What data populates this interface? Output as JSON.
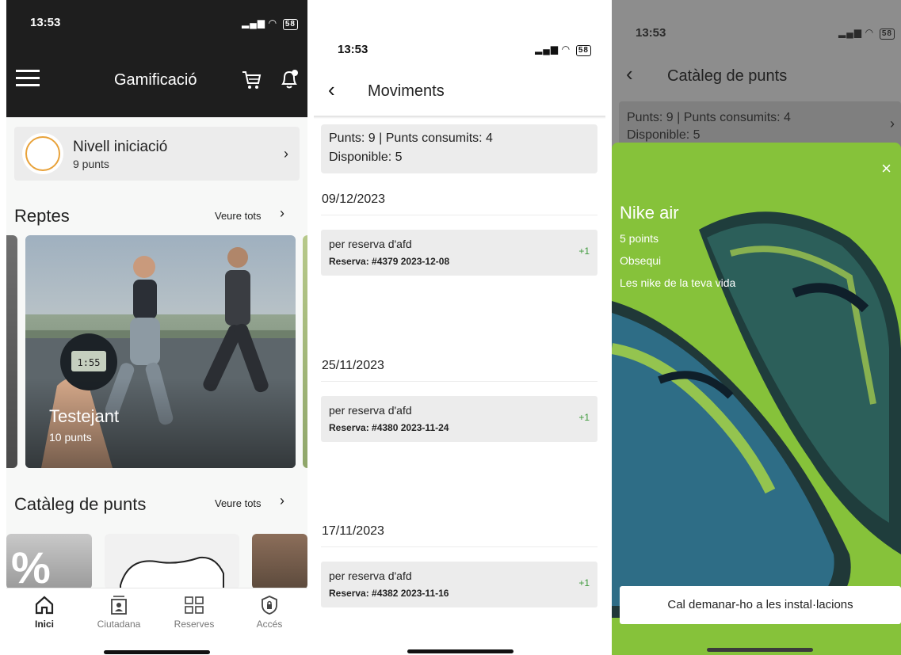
{
  "screen1": {
    "status": {
      "time": "13:53",
      "battery": "58"
    },
    "header": {
      "title": "Gamificació"
    },
    "level": {
      "name": "Nivell iniciació",
      "points": "9 punts"
    },
    "reptes": {
      "title": "Reptes",
      "see_all": "Veure tots",
      "card": {
        "title": "Testejant",
        "points": "10 punts"
      }
    },
    "cataleg": {
      "title": "Catàleg de punts",
      "see_all": "Veure tots"
    },
    "tabs": [
      {
        "label": "Inici",
        "icon": "home-icon",
        "active": true
      },
      {
        "label": "Ciutadana",
        "icon": "citizen-icon",
        "active": false
      },
      {
        "label": "Reserves",
        "icon": "grid-icon",
        "active": false
      },
      {
        "label": "Accés",
        "icon": "shield-lock-icon",
        "active": false
      }
    ]
  },
  "screen2": {
    "status": {
      "time": "13:53",
      "battery": "58"
    },
    "header": {
      "title": "Moviments"
    },
    "summary": {
      "line1": "Punts: 9 | Punts consumits: 4",
      "line2": "Disponible: 5"
    },
    "groups": [
      {
        "date": "09/12/2023",
        "title": "per reserva d'afd",
        "detail": "Reserva: #4379 2023-12-08",
        "points": "+1"
      },
      {
        "date": "25/11/2023",
        "title": "per reserva d'afd",
        "detail": "Reserva: #4380 2023-11-24",
        "points": "+1"
      },
      {
        "date": "17/11/2023",
        "title": "per reserva d'afd",
        "detail": "Reserva: #4382 2023-11-16",
        "points": "+1"
      }
    ]
  },
  "screen3": {
    "status": {
      "time": "13:53",
      "battery": "58"
    },
    "header": {
      "title": "Catàleg de punts"
    },
    "summary": {
      "line1": "Punts: 9 | Punts consumits: 4",
      "line2": "Disponible: 5"
    },
    "product": {
      "name": "Nike air",
      "points": "5 points",
      "type": "Obsequi",
      "description": "Les nike de la teva vida",
      "button": "Cal demanar-ho a les instal·lacions"
    }
  },
  "colors": {
    "dark_header": "#1e1e1e",
    "card_grey": "#ececec",
    "positive_green": "#3f9a3c",
    "accent_orange": "#e8a23a",
    "product_green": "#7cb82f"
  }
}
